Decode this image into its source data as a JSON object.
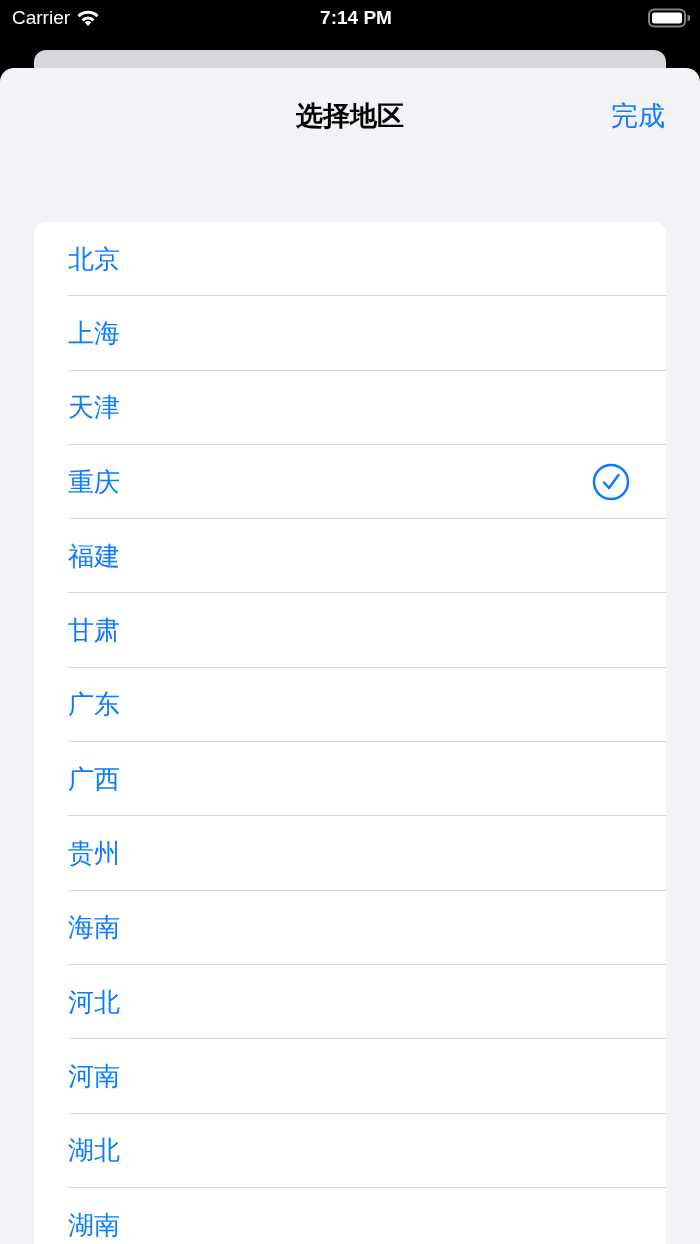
{
  "status_bar": {
    "carrier": "Carrier",
    "time": "7:14 PM"
  },
  "nav": {
    "title": "选择地区",
    "done": "完成"
  },
  "regions": [
    {
      "name": "北京",
      "selected": false
    },
    {
      "name": "上海",
      "selected": false
    },
    {
      "name": "天津",
      "selected": false
    },
    {
      "name": "重庆",
      "selected": true
    },
    {
      "name": "福建",
      "selected": false
    },
    {
      "name": "甘肃",
      "selected": false
    },
    {
      "name": "广东",
      "selected": false
    },
    {
      "name": "广西",
      "selected": false
    },
    {
      "name": "贵州",
      "selected": false
    },
    {
      "name": "海南",
      "selected": false
    },
    {
      "name": "河北",
      "selected": false
    },
    {
      "name": "河南",
      "selected": false
    },
    {
      "name": "湖北",
      "selected": false
    },
    {
      "name": "湖南",
      "selected": false
    }
  ]
}
